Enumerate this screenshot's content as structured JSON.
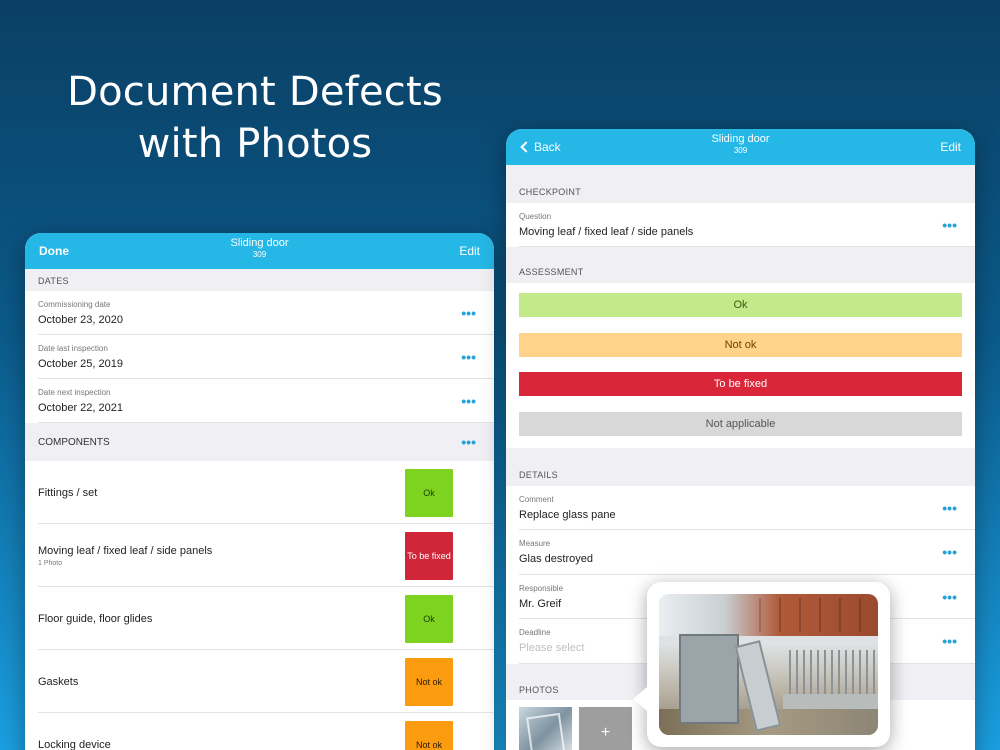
{
  "headline": {
    "line1": "Document Defects",
    "line2": "with Photos"
  },
  "left_tablet": {
    "navbar": {
      "left": "Done",
      "title": "Sliding door",
      "subtitle": "309",
      "right": "Edit"
    },
    "dates_header": "DATES",
    "dates": [
      {
        "label": "Commissioning date",
        "value": "October 23, 2020"
      },
      {
        "label": "Date last inspection",
        "value": "October 25, 2019"
      },
      {
        "label": "Date next inspection",
        "value": "October 22, 2021"
      }
    ],
    "components_header": "COMPONENTS",
    "components": [
      {
        "name": "Fittings / set",
        "sub": "",
        "status": "Ok",
        "status_type": "ok"
      },
      {
        "name": "Moving leaf / fixed leaf / side panels",
        "sub": "1 Photo",
        "status": "To be fixed",
        "status_type": "fix"
      },
      {
        "name": "Floor guide, floor glides",
        "sub": "",
        "status": "Ok",
        "status_type": "ok"
      },
      {
        "name": "Gaskets",
        "sub": "",
        "status": "Not ok",
        "status_type": "notok"
      },
      {
        "name": "Locking device",
        "sub": "",
        "status": "Not ok",
        "status_type": "notok"
      }
    ],
    "more_glyph": "•••"
  },
  "right_tablet": {
    "navbar": {
      "back": "Back",
      "title": "Sliding door",
      "subtitle": "309",
      "right": "Edit"
    },
    "checkpoint_header": "CHECKPOINT",
    "question": {
      "label": "Question",
      "value": "Moving leaf / fixed leaf / side panels"
    },
    "assessment_header": "ASSESSMENT",
    "assessment_options": [
      "Ok",
      "Not ok",
      "To be fixed",
      "Not applicable"
    ],
    "details_header": "DETAILS",
    "details": [
      {
        "label": "Comment",
        "value": "Replace glass pane",
        "placeholder": false
      },
      {
        "label": "Measure",
        "value": "Glas destroyed",
        "placeholder": false
      },
      {
        "label": "Responsible",
        "value": "Mr. Greif",
        "placeholder": false
      },
      {
        "label": "Deadline",
        "value": "Please select",
        "placeholder": true
      }
    ],
    "photos_header": "PHOTOS",
    "add_photo": "+",
    "more_glyph": "•••"
  },
  "colors": {
    "navbar": "#25b7e6",
    "ok": "#7ed321",
    "to_be_fixed": "#d0263a",
    "not_ok": "#fb9b10",
    "assess_ok": "#c3ea8a",
    "assess_not_ok": "#ffd38a",
    "assess_na": "#d8d8d8"
  }
}
